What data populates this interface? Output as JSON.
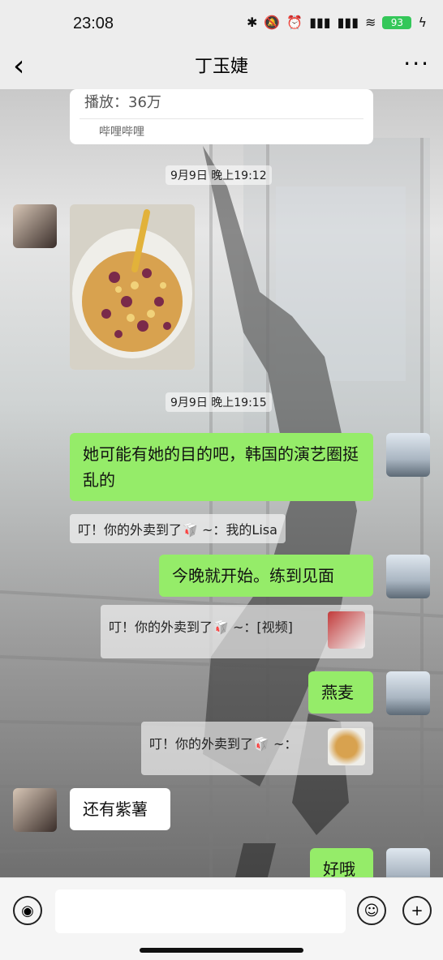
{
  "status_bar": {
    "time": "23:08",
    "icons": [
      "bluetooth-icon",
      "bell-off-icon",
      "alarm-icon",
      "signal-hd-icon",
      "signal-hd-icon",
      "wifi-icon",
      "battery-icon",
      "charging-icon"
    ],
    "battery_level": "93"
  },
  "header": {
    "title": "丁玉婕",
    "back_icon": "chevron-left-icon",
    "more_icon": "more-dots-icon"
  },
  "shared_card": {
    "plays": "播放：36万",
    "source": "哔哩哔哩"
  },
  "messages": {
    "timestamp_1": "9月9日 晚上19:12",
    "timestamp_2": "9月9日 晚上19:15",
    "bubble_1": "她可能有她的目的吧，韩国的演艺圈挺乱的",
    "system_1": "叮！你的外卖到了🥡 ~：我的Lisa",
    "bubble_2": "今晚就开始。练到见面",
    "system_2": "叮！你的外卖到了🥡 ~：[视频]",
    "bubble_3": "燕麦",
    "system_3": "叮！你的外卖到了🥡 ~：",
    "bubble_4": "还有紫薯",
    "bubble_5": "好哦"
  },
  "input_bar": {
    "voice_icon": "voice-icon",
    "emoji_icon": "emoji-icon",
    "plus_icon": "plus-icon",
    "placeholder": ""
  },
  "colors": {
    "sent_bubble": "#95ec69",
    "received_bubble": "#ffffff",
    "header_bg": "#ededed"
  }
}
